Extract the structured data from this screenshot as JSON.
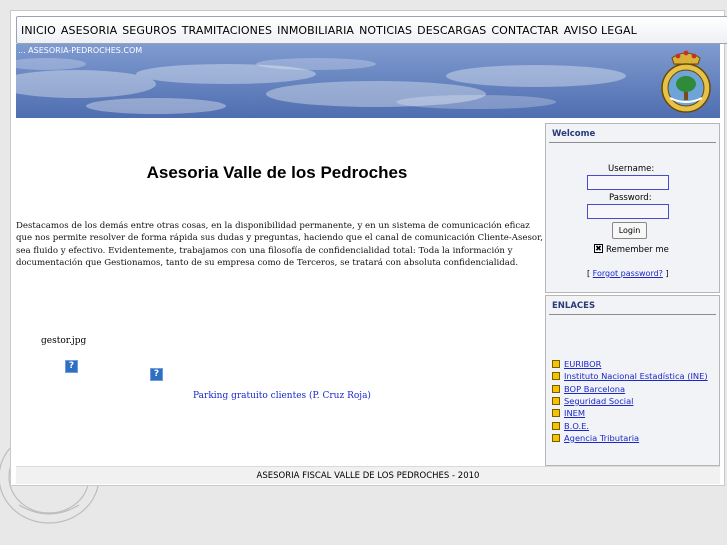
{
  "nav": {
    "items": [
      "INICIO",
      "ASESORIA",
      "SEGUROS",
      "TRAMITACIONES",
      "INMOBILIARIA",
      "NOTICIAS",
      "DESCARGAS",
      "CONTACTAR",
      "AVISO LEGAL"
    ]
  },
  "banner": {
    "site_label": "... ASESORIA-PEDROCHES.COM"
  },
  "main": {
    "title": "Asesoria Valle de los Pedroches",
    "intro": "Destacamos de los demás entre otras cosas, en la disponibilidad permanente, y en un sistema de comunicación eficaz que nos permite resolver de forma rápida sus dudas y preguntas, haciendo que el canal de comunicación Cliente-Asesor, sea fluido y efectivo. Evidentemente, trabajamos con una filosofía de confidencialidad total: Toda la información y documentación que Gestionamos, tanto de su empresa como de Terceros, se tratará con absoluta confidencialidad.",
    "image_alt": "gestor.jpg",
    "broken_icon": "?",
    "parking_link": "Parking gratuito clientes (P. Cruz Roja)"
  },
  "welcome": {
    "title": "Welcome",
    "username_label": "Username:",
    "username_value": "",
    "password_label": "Password:",
    "password_value": "",
    "login_button": "Login",
    "remember_label": "Remember me",
    "remember_checked": true,
    "remember_mark": "✖",
    "forgot_open": "[",
    "forgot_link": "Forgot password?",
    "forgot_close": "]"
  },
  "enlaces": {
    "title": "ENLACES",
    "links": [
      "EURIBOR",
      "Instituto Nacional Estadística (INE)",
      "BOP Barcelona",
      "Seguridad Social",
      "INEM",
      "B.O.E.",
      "Agencia Tributaria"
    ]
  },
  "footer": {
    "text": "ASESORIA FISCAL VALLE DE LOS PEDROCHES - 2010"
  },
  "colors": {
    "banner_blue": "#5c7ab8",
    "link_blue": "#1a27c9",
    "bullet_yellow": "#f4c400",
    "box_title": "#2a3a7a"
  },
  "icons": {
    "emblem": "coat-of-arms-icon",
    "broken_image": "broken-image-icon",
    "bullet": "square-bullet-icon"
  }
}
